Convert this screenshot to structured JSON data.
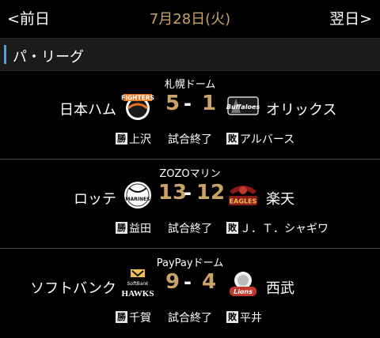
{
  "header": {
    "prev_label": "<前日",
    "date_label": "7月28日(火)",
    "next_label": "翌日>"
  },
  "league": {
    "label": "パ・リーグ"
  },
  "games": [
    {
      "venue": "札幌ドーム",
      "home_team": "日本ハム",
      "home_logo_text": "FIGHTERS",
      "home_score": "5",
      "away_score": "1",
      "away_logo_text": "Buffaloes",
      "away_team": "オリックス",
      "win_badge": "勝",
      "win_pitcher": "上沢",
      "status": "試合終了",
      "loss_badge": "敗",
      "loss_pitcher": "アルバース"
    },
    {
      "venue": "ZOZOマリン",
      "home_team": "ロッテ",
      "home_logo_text": "MARINES",
      "home_score": "13",
      "away_score": "12",
      "away_logo_text": "EAGLES",
      "away_team": "楽天",
      "win_badge": "勝",
      "win_pitcher": "益田",
      "status": "試合終了",
      "loss_badge": "敗",
      "loss_pitcher": "Ｊ．Ｔ．シャギワ"
    },
    {
      "venue": "PayPayドーム",
      "home_team": "ソフトバンク",
      "home_logo_text": "HAWKS",
      "home_score": "9",
      "away_score": "4",
      "away_logo_text": "Lions",
      "away_team": "西武",
      "win_badge": "勝",
      "win_pitcher": "千賀",
      "status": "試合終了",
      "loss_badge": "敗",
      "loss_pitcher": "平井"
    }
  ],
  "colors": {
    "score": "#c9a36a",
    "date": "#c9a36a",
    "league_accent": "#4da3c9"
  }
}
